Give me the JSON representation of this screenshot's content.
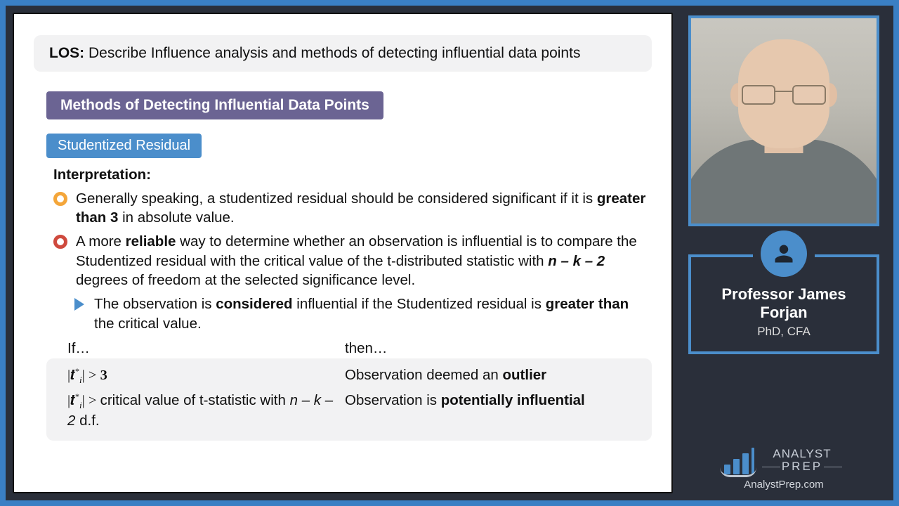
{
  "los": {
    "label": "LOS:",
    "text": "Describe Influence analysis and methods of detecting influential data points"
  },
  "section_title": "Methods of Detecting Influential Data Points",
  "sub_title": "Studentized Residual",
  "interpretation_label": "Interpretation:",
  "bullets": [
    {
      "pre": "Generally speaking, a studentized residual should be considered significant if it is ",
      "bold": "greater than 3",
      "post": " in absolute value."
    },
    {
      "pre": "A more ",
      "bold": "reliable",
      "post1": " way to determine whether an observation is influential is to compare the Studentized residual with the critical value of the t-distributed statistic with ",
      "df": "n – k – 2",
      "post2": " degrees of freedom at the selected significance level."
    }
  ],
  "sub_bullet": {
    "pre": "The observation is ",
    "b1": "considered",
    "mid": " influential if the Studentized residual is ",
    "b2": "greater than",
    "post": " the critical value."
  },
  "table": {
    "if_label": "If…",
    "then_label": "then…",
    "rows": [
      {
        "cond_math": "|𝒕<span style='font-size:12px;vertical-align:super'>*</span><sub style='font-style:italic;font-size:13px'>i</sub>| > <b>3</b>",
        "cond_plain": "",
        "res_pre": "Observation deemed an ",
        "res_bold": "outlier",
        "res_post": ""
      },
      {
        "cond_math": "|𝒕<span style='font-size:12px;vertical-align:super'>*</span><sub style='font-style:italic;font-size:13px'>i</sub>| > ",
        "cond_plain_pre": "critical value of t-statistic with ",
        "cond_df": "n – k – 2",
        "cond_plain_post": " d.f.",
        "res_pre": "Observation is ",
        "res_bold": "potentially influential",
        "res_post": ""
      }
    ]
  },
  "presenter": {
    "name": "Professor James Forjan",
    "credentials": "PhD, CFA"
  },
  "brand": {
    "line1": "ANALYST",
    "line2": "PREP",
    "url": "AnalystPrep.com"
  }
}
